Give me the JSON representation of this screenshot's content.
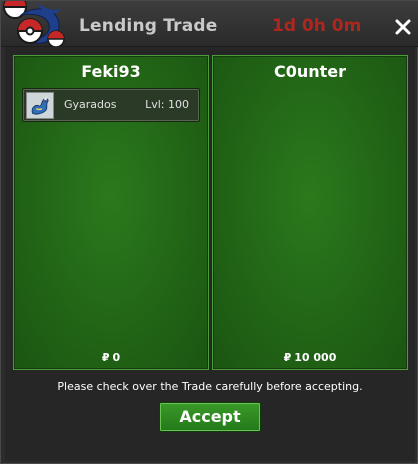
{
  "window": {
    "title": "Lending Trade",
    "timer": "1d 0h 0m",
    "close_icon": "close-icon"
  },
  "trade": {
    "left": {
      "player": "Feki93",
      "items": [
        {
          "icon": "gyarados-sprite-icon",
          "name": "Gyarados",
          "level": "Lvl: 100"
        }
      ],
      "money_symbol": "₽",
      "money": "0"
    },
    "right": {
      "player": "C0unter",
      "items": [],
      "money_symbol": "₽",
      "money": "10 000"
    }
  },
  "footer": {
    "notice": "Please check over the Trade carefully before accepting.",
    "accept_label": "Accept"
  },
  "colors": {
    "panel_green": "#226516",
    "timer_red": "#b0261f",
    "accept_green": "#2f8a22"
  }
}
